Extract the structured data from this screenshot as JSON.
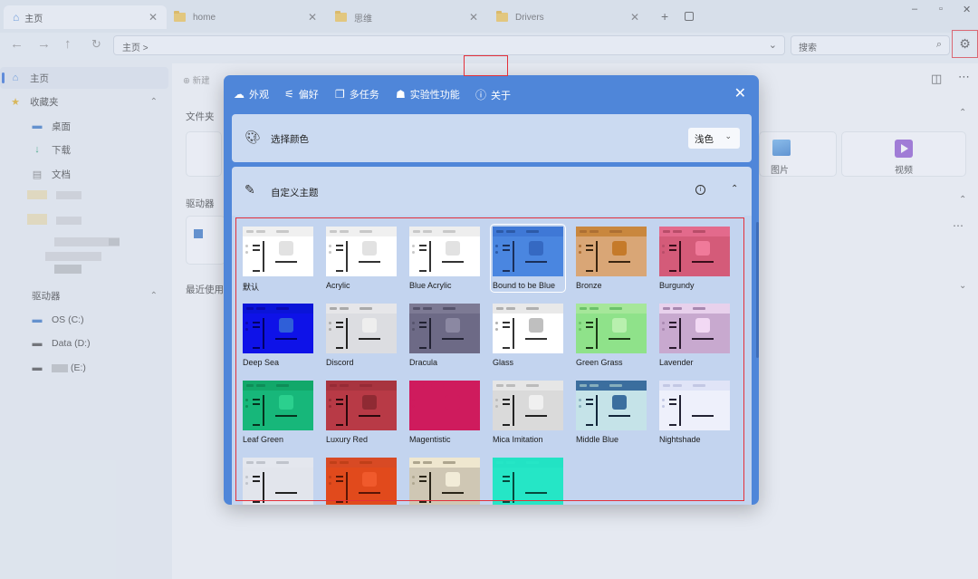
{
  "tabs": [
    {
      "label": "主页",
      "icon": "home-icon"
    },
    {
      "label": "home",
      "icon": "folder-icon"
    },
    {
      "label": "思维",
      "icon": "folder-icon"
    },
    {
      "label": "Drivers",
      "icon": "folder-icon"
    }
  ],
  "tab_add_label": "+",
  "address": {
    "path": "主页 >",
    "search_placeholder": "搜索"
  },
  "sidebar": {
    "home": "主页",
    "favorites": "收藏夹",
    "fav_items": [
      "桌面",
      "下载",
      "文档"
    ],
    "drives_header": "驱动器",
    "drives": [
      "OS (C:)",
      "Data (D:)",
      "(E:)"
    ]
  },
  "main": {
    "new_label": "新建",
    "folders_header": "文件夹",
    "drives_header": "驱动器",
    "recent_header": "最近使用",
    "tiles": [
      "图片",
      "视频"
    ]
  },
  "dialog": {
    "tabs": [
      {
        "label": "外观",
        "icon": "appearance-icon"
      },
      {
        "label": "偏好",
        "icon": "preferences-icon"
      },
      {
        "label": "多任务",
        "icon": "multitask-icon"
      },
      {
        "label": "实验性功能",
        "icon": "experimental-icon"
      },
      {
        "label": "关于",
        "icon": "about-icon"
      }
    ],
    "color_label": "选择颜色",
    "color_value": "浅色",
    "custom_theme_label": "自定义主题",
    "themes": [
      {
        "name": "默认",
        "bar": "#f0f0f0",
        "bg": "#ffffff",
        "fg": "#333333",
        "acc": "#e2e2e2",
        "dot": "#c8c8c8"
      },
      {
        "name": "Acrylic",
        "bar": "#f0f0f0",
        "bg": "#ffffff",
        "fg": "#333333",
        "acc": "#e2e2e2",
        "dot": "#c8c8c8"
      },
      {
        "name": "Blue Acrylic",
        "bar": "#eeeeee",
        "bg": "#ffffff",
        "fg": "#333333",
        "acc": "#e2e2e2",
        "dot": "#c8c8c8"
      },
      {
        "name": "Bound to be Blue",
        "bar": "#3f78d6",
        "bg": "#4a86e0",
        "fg": "#1a2f5a",
        "acc": "#3569c2",
        "dot": "#2c5aa8"
      },
      {
        "name": "Bronze",
        "bar": "#c9873e",
        "bg": "#d9a676",
        "fg": "#3a2510",
        "acc": "#c57a2a",
        "dot": "#ad6f33"
      },
      {
        "name": "Burgundy",
        "bar": "#e36a8c",
        "bg": "#d45b79",
        "fg": "#3a0d1a",
        "acc": "#f07a9a",
        "dot": "#b84d69"
      },
      {
        "name": "Deep Sea",
        "bar": "#0a14d8",
        "bg": "#0e12e8",
        "fg": "#000066",
        "acc": "#2f5fd8",
        "dot": "#0a0ab0"
      },
      {
        "name": "Discord",
        "bar": "#e6e6e9",
        "bg": "#dcdde1",
        "fg": "#222222",
        "acc": "#eeeeee",
        "dot": "#aaaaaa"
      },
      {
        "name": "Dracula",
        "bar": "#7d7a94",
        "bg": "#6d6a86",
        "fg": "#222233",
        "acc": "#8b88a2",
        "dot": "#55536b"
      },
      {
        "name": "Glass",
        "bar": "#e9e9e9",
        "bg": "#ffffff",
        "fg": "#333333",
        "acc": "#bfbfbf",
        "dot": "#b0b0b0"
      },
      {
        "name": "Green Grass",
        "bar": "#a6e79a",
        "bg": "#8fe28a",
        "fg": "#1d3a17",
        "acc": "#b8f0ae",
        "dot": "#6cc26a"
      },
      {
        "name": "Lavender",
        "bar": "#e8d1ec",
        "bg": "#c8a9cf",
        "fg": "#2a1a2f",
        "acc": "#f2d9f4",
        "dot": "#a888b0"
      },
      {
        "name": "Leaf Green",
        "bar": "#12a86a",
        "bg": "#17b77a",
        "fg": "#06331e",
        "acc": "#2bd08e",
        "dot": "#0f8d58"
      },
      {
        "name": "Luxury Red",
        "bar": "#a8343f",
        "bg": "#b83a46",
        "fg": "#2a080c",
        "acc": "#8f2a33",
        "dot": "#962b36"
      },
      {
        "name": "Magentistic",
        "bar": "#cf1b5d",
        "bg": "#cf1b5d",
        "fg": "#cf1b5d",
        "acc": "#cf1b5d",
        "dot": "#cf1b5d"
      },
      {
        "name": "Mica Imitation",
        "bar": "#e6e6e6",
        "bg": "#dadada",
        "fg": "#222222",
        "acc": "#f0f0f0",
        "dot": "#bbbbbb"
      },
      {
        "name": "Middle Blue",
        "bar": "#3b6e9e",
        "bg": "#c5e3e8",
        "fg": "#13263a",
        "acc": "#3b6e9e",
        "dot": "#86aebc"
      },
      {
        "name": "Nightshade",
        "bar": "#e0e4f7",
        "bg": "#eef0fb",
        "fg": "#222233",
        "acc": "#eef0fb",
        "dot": "#c3c8e4"
      },
      {
        "name": "",
        "bar": "#e4e7ee",
        "bg": "#e2e5ec",
        "fg": "#222222",
        "acc": "#e2e5ec",
        "dot": "#c0c4cc"
      },
      {
        "name": "",
        "bar": "#d84a24",
        "bg": "#e14a1c",
        "fg": "#5a1606",
        "acc": "#f05a2c",
        "dot": "#c03f18"
      },
      {
        "name": "",
        "bar": "#efe7cf",
        "bg": "#cfc7b4",
        "fg": "#2a2518",
        "acc": "#f2ecd8",
        "dot": "#aea68f"
      },
      {
        "name": "",
        "bar": "#22e3c4",
        "bg": "#25e6c6",
        "fg": "#064a3d",
        "acc": "#25e6c6",
        "dot": "#25e6c6"
      }
    ],
    "selected_theme": "Bound to be Blue"
  },
  "colors": {
    "accent": "#4f86d9",
    "highlight_red": "#e3303a"
  }
}
